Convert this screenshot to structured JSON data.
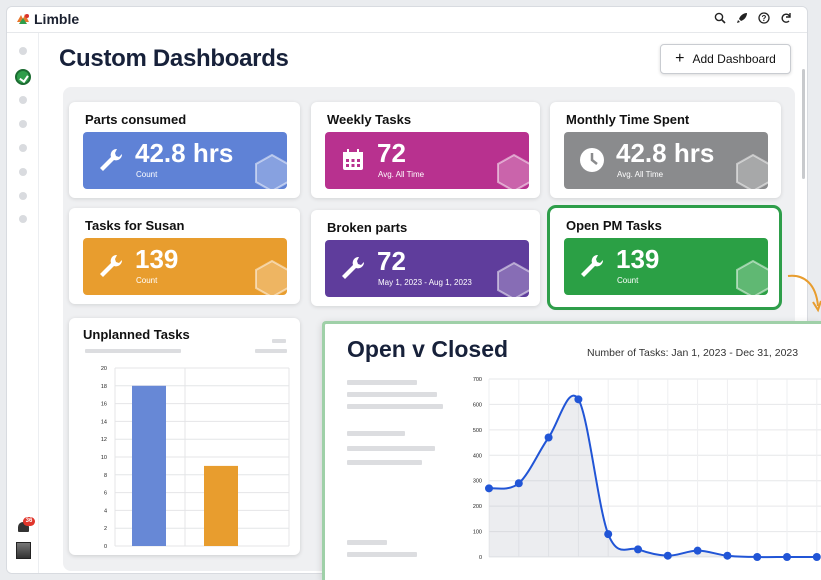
{
  "app": {
    "name": "Limble"
  },
  "topbar": {
    "icons": [
      "search-icon",
      "rocket-icon",
      "help-icon",
      "refresh-icon"
    ]
  },
  "sidebar": {
    "notification_count": "36"
  },
  "page": {
    "title": "Custom Dashboards",
    "add_button_label": "Add Dashboard"
  },
  "widgets": [
    {
      "title": "Parts consumed",
      "value": "42.8 hrs",
      "sub": "Count",
      "color": "#5f82d6",
      "icon": "wrench-icon"
    },
    {
      "title": "Weekly Tasks",
      "value": "72",
      "sub": "Avg. All Time",
      "color": "#b8318f",
      "icon": "calendar-icon"
    },
    {
      "title": "Monthly Time Spent",
      "value": "42.8 hrs",
      "sub": "Avg. All Time",
      "color": "#8a8b8d",
      "icon": "clock-icon"
    },
    {
      "title": "Tasks for Susan",
      "value": "139",
      "sub": "Count",
      "color": "#e89d2e",
      "icon": "wrench-icon"
    },
    {
      "title": "Broken parts",
      "value": "72",
      "sub": "May 1, 2023 - Aug 1, 2023",
      "color": "#5f3d9c",
      "icon": "wrench-icon"
    },
    {
      "title": "Open PM Tasks",
      "value": "139",
      "sub": "Count",
      "color": "#2ba045",
      "icon": "wrench-icon",
      "selected": true
    }
  ],
  "chart_data": [
    {
      "type": "bar",
      "title": "Unplanned Tasks",
      "categories": [
        "",
        ""
      ],
      "series": [
        {
          "values": [
            18,
            9
          ]
        }
      ],
      "colors": [
        "#6788d6",
        "#e89d2e"
      ],
      "yticks": [
        0,
        2,
        4,
        6,
        8,
        10,
        12,
        14,
        16,
        18,
        20
      ],
      "ylim": [
        0,
        20
      ],
      "grid": true
    },
    {
      "type": "line",
      "title": "Open v Closed",
      "subtitle": "Number of Tasks: Jan 1, 2023 - Dec 31, 2023",
      "x": [
        1,
        2,
        3,
        4,
        5,
        6,
        7,
        8,
        9,
        10,
        11,
        12
      ],
      "series": [
        {
          "values": [
            270,
            290,
            470,
            620,
            90,
            30,
            5,
            25,
            5,
            0,
            0,
            0
          ]
        }
      ],
      "color": "#2155d6",
      "yticks": [
        0,
        100,
        200,
        300,
        400,
        500,
        600,
        700
      ],
      "ylim": [
        0,
        700
      ],
      "grid": true
    }
  ]
}
